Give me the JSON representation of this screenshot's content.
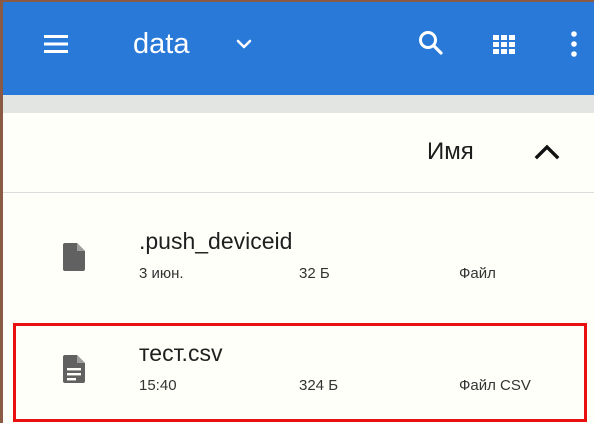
{
  "appbar": {
    "menu_icon": "menu-icon",
    "title": "data",
    "title_icon": "chevron-down-icon",
    "search_icon": "search-icon",
    "grid_icon": "grid-view-icon",
    "more_icon": "more-vertical-icon",
    "background_color": "#2979d8"
  },
  "sort_header": {
    "label": "Имя",
    "direction_icon": "chevron-up-icon"
  },
  "files": [
    {
      "name": ".push_deviceid",
      "date": "3 июн.",
      "size": "32 Б",
      "type": "Файл",
      "icon": "file-icon"
    },
    {
      "name": "тест.csv",
      "date": "15:40",
      "size": "324 Б",
      "type": "Файл CSV",
      "icon": "text-file-icon",
      "highlighted": true
    }
  ],
  "highlight_color": "#e81010"
}
